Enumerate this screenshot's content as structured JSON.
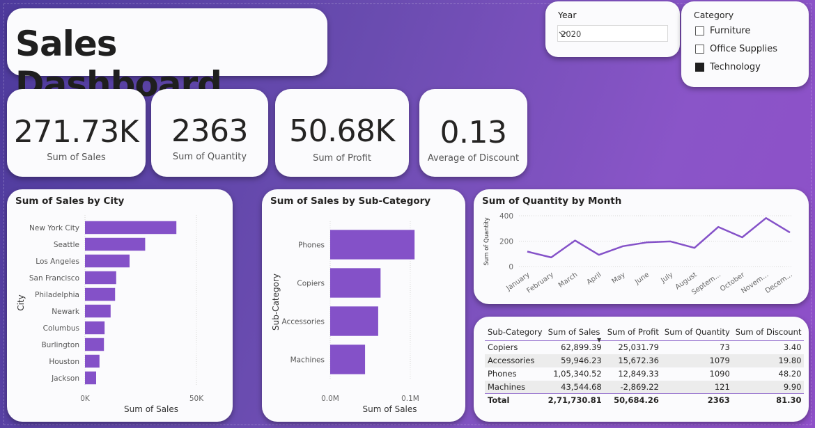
{
  "title": "Sales Dashboard",
  "year_slicer": {
    "label": "Year",
    "value": "2020"
  },
  "category_slicer": {
    "label": "Category",
    "items": [
      {
        "label": "Furniture",
        "checked": false
      },
      {
        "label": "Office Supplies",
        "checked": false
      },
      {
        "label": "Technology",
        "checked": true
      }
    ]
  },
  "kpis": [
    {
      "value": "271.73K",
      "label": "Sum of Sales"
    },
    {
      "value": "2363",
      "label": "Sum of Quantity"
    },
    {
      "value": "50.68K",
      "label": "Sum of Profit"
    },
    {
      "value": "0.13",
      "label": "Average of Discount"
    }
  ],
  "colors": {
    "bar": "#8451c8",
    "line": "#8451c8",
    "accent": "#9c7ad1"
  },
  "chart_data": [
    {
      "type": "bar",
      "orientation": "horizontal",
      "title": "Sum of Sales by City",
      "xlabel": "Sum of Sales",
      "ylabel": "City",
      "categories": [
        "New York City",
        "Seattle",
        "Los Angeles",
        "San Francisco",
        "Philadelphia",
        "Newark",
        "Columbus",
        "Burlington",
        "Houston",
        "Jackson"
      ],
      "values": [
        41000,
        27000,
        20000,
        14000,
        13500,
        11500,
        8800,
        8500,
        6500,
        5000
      ],
      "xlim": [
        0,
        50000
      ],
      "xticks": [
        "0K",
        "50K"
      ],
      "grid": true
    },
    {
      "type": "bar",
      "orientation": "horizontal",
      "title": "Sum of Sales by Sub-Category",
      "xlabel": "Sum of Sales",
      "ylabel": "Sub-Category",
      "categories": [
        "Phones",
        "Copiers",
        "Accessories",
        "Machines"
      ],
      "values": [
        105340.52,
        62899.39,
        59946.23,
        43544.68
      ],
      "xlim": [
        0,
        100000
      ],
      "xticks": [
        "0.0M",
        "0.1M"
      ],
      "grid": true
    },
    {
      "type": "line",
      "title": "Sum of Quantity by Month",
      "xlabel": "",
      "ylabel": "Sum of Quantity",
      "x": [
        "January",
        "February",
        "March",
        "April",
        "May",
        "June",
        "July",
        "August",
        "Septem...",
        "October",
        "Novem...",
        "Decem..."
      ],
      "values": [
        118,
        72,
        205,
        92,
        160,
        190,
        198,
        147,
        312,
        230,
        382,
        268
      ],
      "ylim": [
        0,
        400
      ],
      "yticks": [
        "0",
        "200",
        "400"
      ],
      "grid": true
    },
    {
      "type": "table",
      "columns": [
        "Sub-Category",
        "Sum of Sales",
        "Sum of Profit",
        "Sum of Quantity",
        "Sum of Discount"
      ],
      "rows": [
        [
          "Copiers",
          "62,899.39",
          "25,031.79",
          "73",
          "3.40"
        ],
        [
          "Accessories",
          "59,946.23",
          "15,672.36",
          "1079",
          "19.80"
        ],
        [
          "Phones",
          "1,05,340.52",
          "12,849.33",
          "1090",
          "48.20"
        ],
        [
          "Machines",
          "43,544.68",
          "-2,869.22",
          "121",
          "9.90"
        ]
      ],
      "total": [
        "Total",
        "2,71,730.81",
        "50,684.26",
        "2363",
        "81.30"
      ]
    }
  ]
}
